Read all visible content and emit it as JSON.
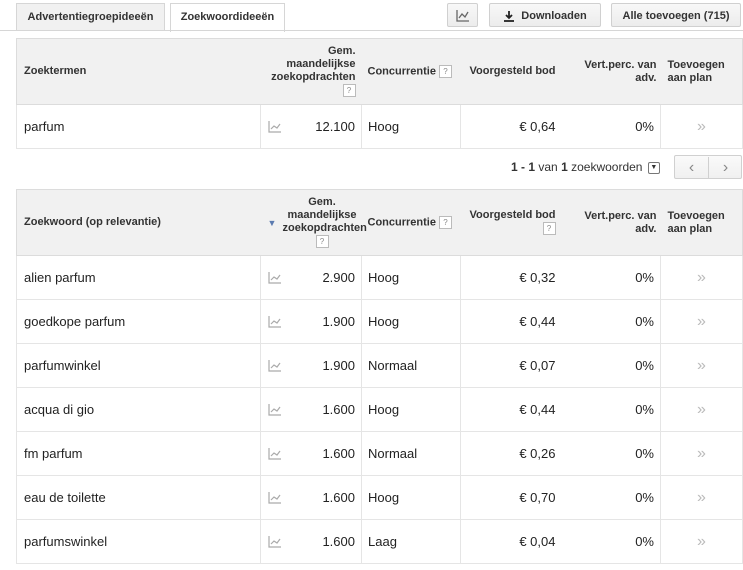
{
  "tabs": {
    "adgroups": "Advertentiegroepideeën",
    "keywords": "Zoekwoordideeën"
  },
  "toolbar": {
    "download": "Downloaden",
    "add_all": "Alle toevoegen (715)"
  },
  "search_table": {
    "headers": {
      "term": "Zoektermen",
      "volume": "Gem. maandelijkse zoekopdrachten",
      "competition": "Concurrentie",
      "bid": "Voorgesteld bod",
      "share": "Vert.perc. van adv.",
      "add": "Toevoegen aan plan"
    },
    "rows": [
      {
        "term": "parfum",
        "volume": "12.100",
        "competition": "Hoog",
        "bid": "€ 0,64",
        "share": "0%"
      }
    ]
  },
  "pagination": {
    "range": "1 - 1",
    "of": "van",
    "total": "1",
    "unit": "zoekwoorden"
  },
  "keyword_table": {
    "headers": {
      "keyword": "Zoekwoord (op relevantie)",
      "volume": "Gem. maandelijkse zoekopdrachten",
      "competition": "Concurrentie",
      "bid": "Voorgesteld bod",
      "share": "Vert.perc. van adv.",
      "add": "Toevoegen aan plan"
    },
    "rows": [
      {
        "term": "alien parfum",
        "volume": "2.900",
        "competition": "Hoog",
        "bid": "€ 0,32",
        "share": "0%"
      },
      {
        "term": "goedkope parfum",
        "volume": "1.900",
        "competition": "Hoog",
        "bid": "€ 0,44",
        "share": "0%"
      },
      {
        "term": "parfumwinkel",
        "volume": "1.900",
        "competition": "Normaal",
        "bid": "€ 0,07",
        "share": "0%"
      },
      {
        "term": "acqua di gio",
        "volume": "1.600",
        "competition": "Hoog",
        "bid": "€ 0,44",
        "share": "0%"
      },
      {
        "term": "fm parfum",
        "volume": "1.600",
        "competition": "Normaal",
        "bid": "€ 0,26",
        "share": "0%"
      },
      {
        "term": "eau de toilette",
        "volume": "1.600",
        "competition": "Hoog",
        "bid": "€ 0,70",
        "share": "0%"
      },
      {
        "term": "parfumswinkel",
        "volume": "1.600",
        "competition": "Laag",
        "bid": "€ 0,04",
        "share": "0%"
      }
    ]
  }
}
